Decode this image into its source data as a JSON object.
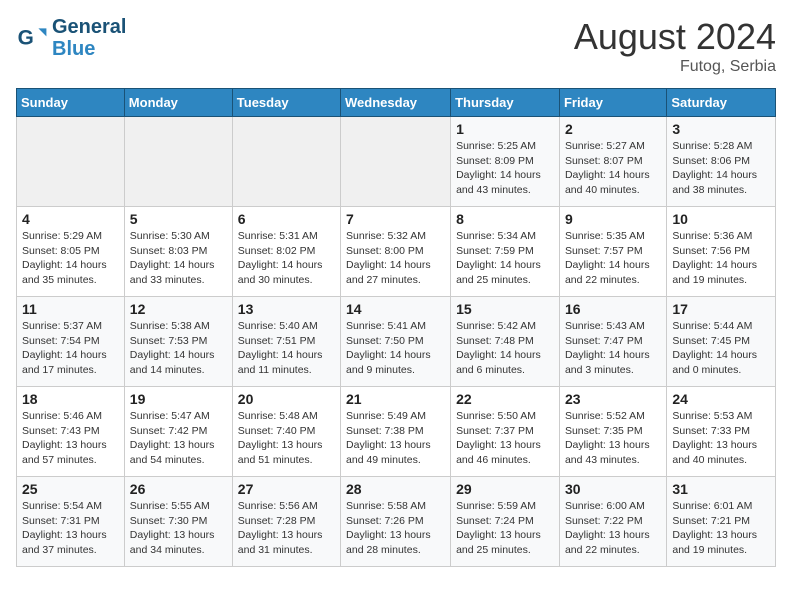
{
  "header": {
    "logo_line1": "General",
    "logo_line2": "Blue",
    "month_year": "August 2024",
    "location": "Futog, Serbia"
  },
  "weekdays": [
    "Sunday",
    "Monday",
    "Tuesday",
    "Wednesday",
    "Thursday",
    "Friday",
    "Saturday"
  ],
  "weeks": [
    [
      {
        "day": "",
        "info": ""
      },
      {
        "day": "",
        "info": ""
      },
      {
        "day": "",
        "info": ""
      },
      {
        "day": "",
        "info": ""
      },
      {
        "day": "1",
        "info": "Sunrise: 5:25 AM\nSunset: 8:09 PM\nDaylight: 14 hours\nand 43 minutes."
      },
      {
        "day": "2",
        "info": "Sunrise: 5:27 AM\nSunset: 8:07 PM\nDaylight: 14 hours\nand 40 minutes."
      },
      {
        "day": "3",
        "info": "Sunrise: 5:28 AM\nSunset: 8:06 PM\nDaylight: 14 hours\nand 38 minutes."
      }
    ],
    [
      {
        "day": "4",
        "info": "Sunrise: 5:29 AM\nSunset: 8:05 PM\nDaylight: 14 hours\nand 35 minutes."
      },
      {
        "day": "5",
        "info": "Sunrise: 5:30 AM\nSunset: 8:03 PM\nDaylight: 14 hours\nand 33 minutes."
      },
      {
        "day": "6",
        "info": "Sunrise: 5:31 AM\nSunset: 8:02 PM\nDaylight: 14 hours\nand 30 minutes."
      },
      {
        "day": "7",
        "info": "Sunrise: 5:32 AM\nSunset: 8:00 PM\nDaylight: 14 hours\nand 27 minutes."
      },
      {
        "day": "8",
        "info": "Sunrise: 5:34 AM\nSunset: 7:59 PM\nDaylight: 14 hours\nand 25 minutes."
      },
      {
        "day": "9",
        "info": "Sunrise: 5:35 AM\nSunset: 7:57 PM\nDaylight: 14 hours\nand 22 minutes."
      },
      {
        "day": "10",
        "info": "Sunrise: 5:36 AM\nSunset: 7:56 PM\nDaylight: 14 hours\nand 19 minutes."
      }
    ],
    [
      {
        "day": "11",
        "info": "Sunrise: 5:37 AM\nSunset: 7:54 PM\nDaylight: 14 hours\nand 17 minutes."
      },
      {
        "day": "12",
        "info": "Sunrise: 5:38 AM\nSunset: 7:53 PM\nDaylight: 14 hours\nand 14 minutes."
      },
      {
        "day": "13",
        "info": "Sunrise: 5:40 AM\nSunset: 7:51 PM\nDaylight: 14 hours\nand 11 minutes."
      },
      {
        "day": "14",
        "info": "Sunrise: 5:41 AM\nSunset: 7:50 PM\nDaylight: 14 hours\nand 9 minutes."
      },
      {
        "day": "15",
        "info": "Sunrise: 5:42 AM\nSunset: 7:48 PM\nDaylight: 14 hours\nand 6 minutes."
      },
      {
        "day": "16",
        "info": "Sunrise: 5:43 AM\nSunset: 7:47 PM\nDaylight: 14 hours\nand 3 minutes."
      },
      {
        "day": "17",
        "info": "Sunrise: 5:44 AM\nSunset: 7:45 PM\nDaylight: 14 hours\nand 0 minutes."
      }
    ],
    [
      {
        "day": "18",
        "info": "Sunrise: 5:46 AM\nSunset: 7:43 PM\nDaylight: 13 hours\nand 57 minutes."
      },
      {
        "day": "19",
        "info": "Sunrise: 5:47 AM\nSunset: 7:42 PM\nDaylight: 13 hours\nand 54 minutes."
      },
      {
        "day": "20",
        "info": "Sunrise: 5:48 AM\nSunset: 7:40 PM\nDaylight: 13 hours\nand 51 minutes."
      },
      {
        "day": "21",
        "info": "Sunrise: 5:49 AM\nSunset: 7:38 PM\nDaylight: 13 hours\nand 49 minutes."
      },
      {
        "day": "22",
        "info": "Sunrise: 5:50 AM\nSunset: 7:37 PM\nDaylight: 13 hours\nand 46 minutes."
      },
      {
        "day": "23",
        "info": "Sunrise: 5:52 AM\nSunset: 7:35 PM\nDaylight: 13 hours\nand 43 minutes."
      },
      {
        "day": "24",
        "info": "Sunrise: 5:53 AM\nSunset: 7:33 PM\nDaylight: 13 hours\nand 40 minutes."
      }
    ],
    [
      {
        "day": "25",
        "info": "Sunrise: 5:54 AM\nSunset: 7:31 PM\nDaylight: 13 hours\nand 37 minutes."
      },
      {
        "day": "26",
        "info": "Sunrise: 5:55 AM\nSunset: 7:30 PM\nDaylight: 13 hours\nand 34 minutes."
      },
      {
        "day": "27",
        "info": "Sunrise: 5:56 AM\nSunset: 7:28 PM\nDaylight: 13 hours\nand 31 minutes."
      },
      {
        "day": "28",
        "info": "Sunrise: 5:58 AM\nSunset: 7:26 PM\nDaylight: 13 hours\nand 28 minutes."
      },
      {
        "day": "29",
        "info": "Sunrise: 5:59 AM\nSunset: 7:24 PM\nDaylight: 13 hours\nand 25 minutes."
      },
      {
        "day": "30",
        "info": "Sunrise: 6:00 AM\nSunset: 7:22 PM\nDaylight: 13 hours\nand 22 minutes."
      },
      {
        "day": "31",
        "info": "Sunrise: 6:01 AM\nSunset: 7:21 PM\nDaylight: 13 hours\nand 19 minutes."
      }
    ]
  ]
}
